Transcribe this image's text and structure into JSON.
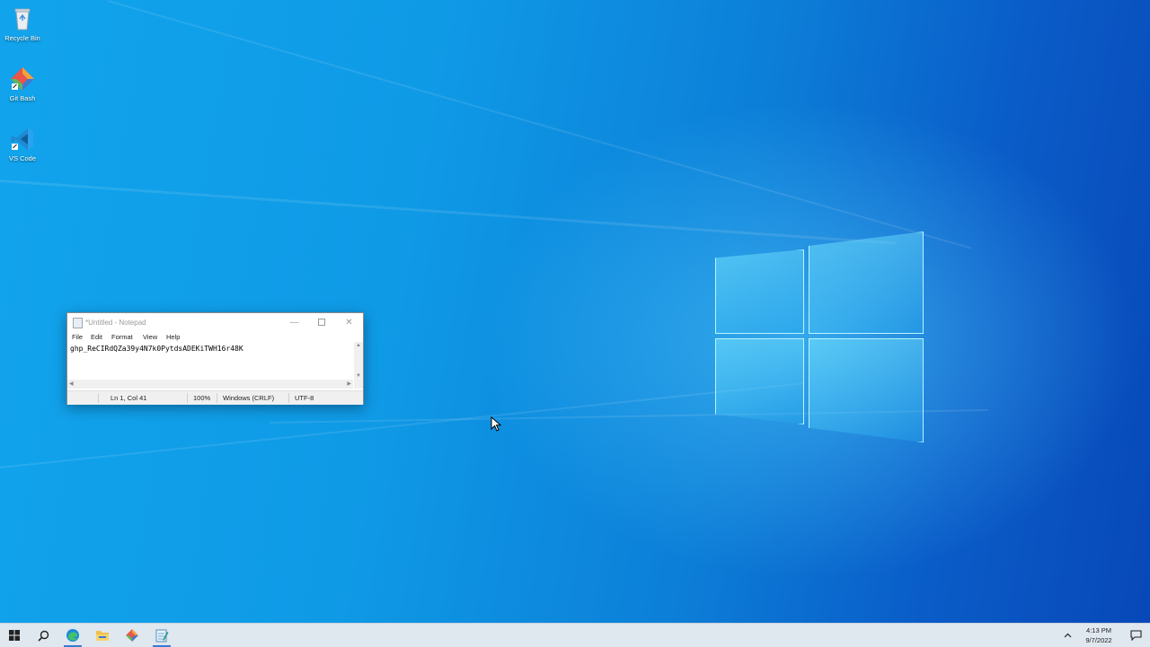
{
  "desktop": {
    "icons": [
      {
        "label": "Recycle Bin",
        "icon": "recycle-bin-icon"
      },
      {
        "label": "Git Bash",
        "icon": "git-bash-icon"
      },
      {
        "label": "VS Code",
        "icon": "vscode-icon"
      }
    ],
    "accent_colors": {
      "wallpaper_light": "#11a4ec",
      "wallpaper_dark": "#0848b8",
      "logo_glow": "#a0f0ff"
    }
  },
  "notepad": {
    "title": "*Untitled - Notepad",
    "menu": [
      "File",
      "Edit",
      "Format",
      "View",
      "Help"
    ],
    "content": "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",
    "status": {
      "position": "Ln 1, Col 41",
      "zoom": "100%",
      "line_ending": "Windows (CRLF)",
      "encoding": "UTF-8"
    }
  },
  "taskbar": {
    "apps": [
      "start-icon",
      "search-icon",
      "edge-icon",
      "file-explorer-icon",
      "git-bash-icon",
      "notepad-icon"
    ],
    "clock": {
      "time": "4:13 PM",
      "date": "9/7/2022"
    }
  }
}
